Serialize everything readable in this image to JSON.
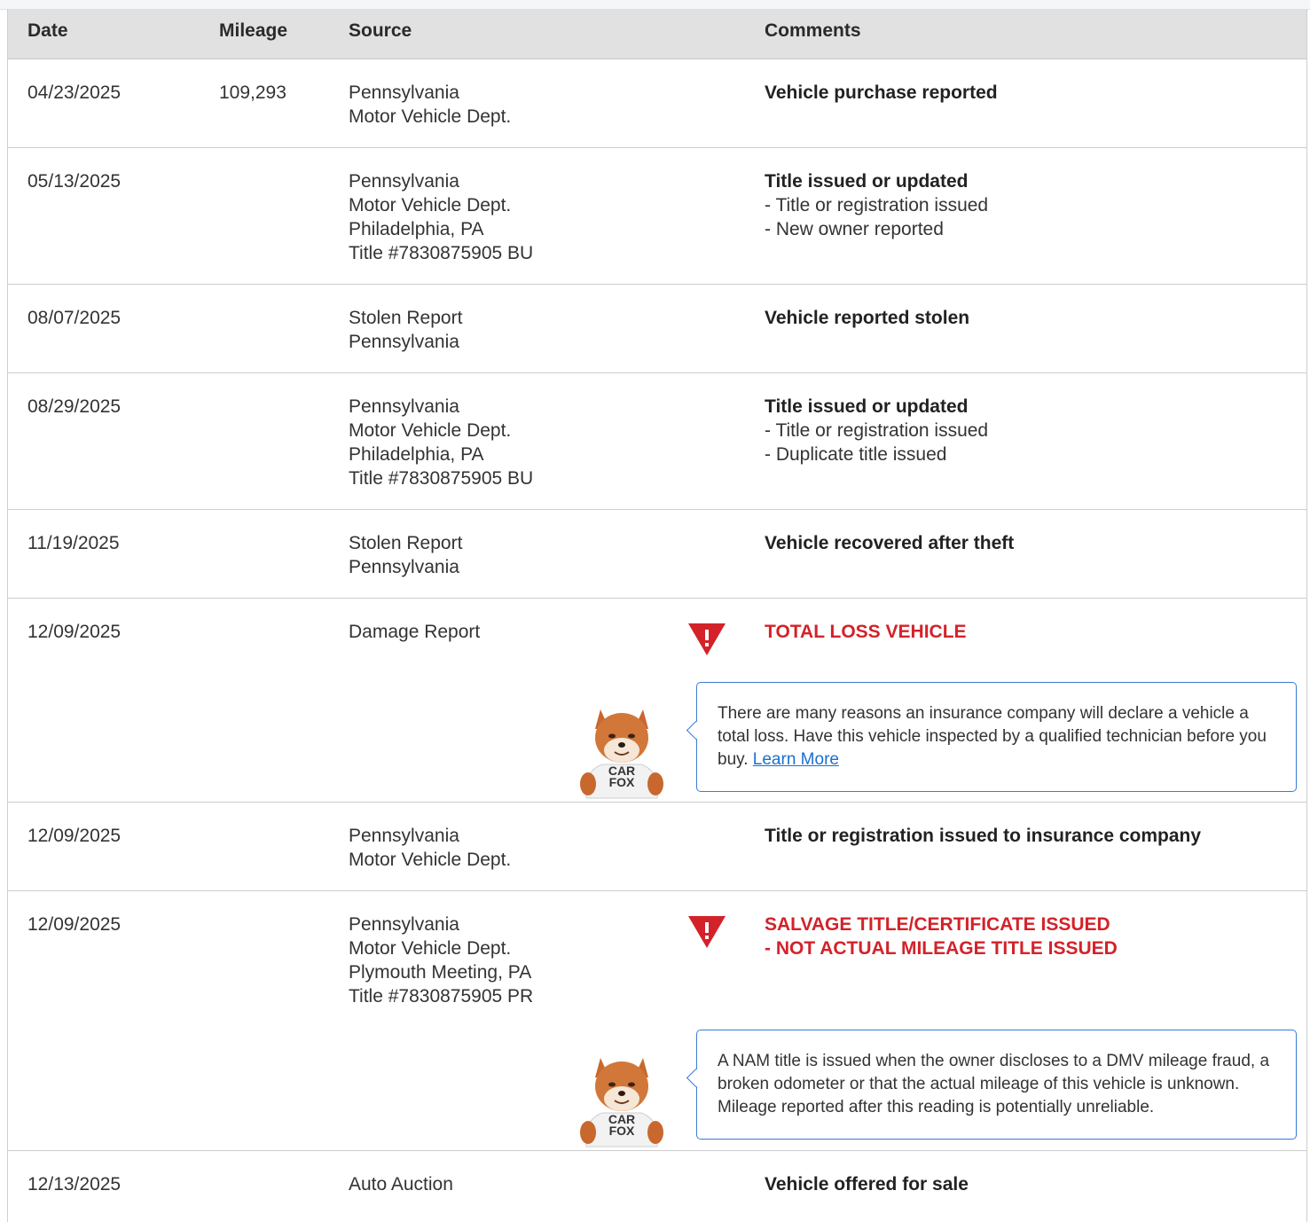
{
  "columns": {
    "date": "Date",
    "mileage": "Mileage",
    "source": "Source",
    "comments": "Comments"
  },
  "rows": [
    {
      "date": "04/23/2025",
      "mileage": "109,293",
      "source": [
        "Pennsylvania",
        "Motor Vehicle Dept."
      ],
      "title": "Vehicle purchase reported",
      "items": []
    },
    {
      "date": "05/13/2025",
      "mileage": "",
      "source": [
        "Pennsylvania",
        "Motor Vehicle Dept.",
        "Philadelphia, PA",
        "Title #7830875905 BU"
      ],
      "title": "Title issued or updated",
      "items": [
        "Title or registration issued",
        "New owner reported"
      ]
    },
    {
      "date": "08/07/2025",
      "mileage": "",
      "source": [
        "Stolen Report",
        "Pennsylvania"
      ],
      "title": "Vehicle reported stolen",
      "items": []
    },
    {
      "date": "08/29/2025",
      "mileage": "",
      "source": [
        "Pennsylvania",
        "Motor Vehicle Dept.",
        "Philadelphia, PA",
        "Title #7830875905 BU"
      ],
      "title": "Title issued or updated",
      "items": [
        "Title or registration issued",
        "Duplicate title issued"
      ]
    },
    {
      "date": "11/19/2025",
      "mileage": "",
      "source": [
        "Stolen Report",
        "Pennsylvania"
      ],
      "title": "Vehicle recovered after theft",
      "items": []
    },
    {
      "date": "12/09/2025",
      "mileage": "",
      "source": [
        "Damage Report"
      ],
      "alert_title": "TOTAL LOSS VEHICLE",
      "alert_items": [],
      "tip": "There are many reasons an insurance company will declare a vehicle a total loss. Have this vehicle inspected by a qualified technician before you buy.",
      "tip_link": "Learn More"
    },
    {
      "date": "12/09/2025",
      "mileage": "",
      "source": [
        "Pennsylvania",
        "Motor Vehicle Dept."
      ],
      "title": "Title or registration issued to insurance company",
      "items": []
    },
    {
      "date": "12/09/2025",
      "mileage": "",
      "source": [
        "Pennsylvania",
        "Motor Vehicle Dept.",
        "Plymouth Meeting, PA",
        "Title #7830875905 PR"
      ],
      "alert_title": "SALVAGE TITLE/CERTIFICATE ISSUED",
      "alert_items": [
        "NOT ACTUAL MILEAGE TITLE ISSUED"
      ],
      "tip": "A NAM title is issued when the owner discloses to a DMV mileage fraud, a broken odometer or that the actual mileage of this vehicle is unknown. Mileage reported after this reading is potentially unreliable."
    },
    {
      "date": "12/13/2025",
      "mileage": "",
      "source": [
        "Auto Auction"
      ],
      "title": "Vehicle offered for sale",
      "items": []
    }
  ],
  "fox_shirt": [
    "CAR",
    "FOX"
  ],
  "colors": {
    "alert": "#d3222a",
    "header_bg": "#e1e1e1",
    "tip_border": "#3a7bd5",
    "link": "#1b6fd1"
  },
  "icons": {
    "alert": "warning-triangle-icon",
    "mascot": "carfox-mascot-icon"
  }
}
